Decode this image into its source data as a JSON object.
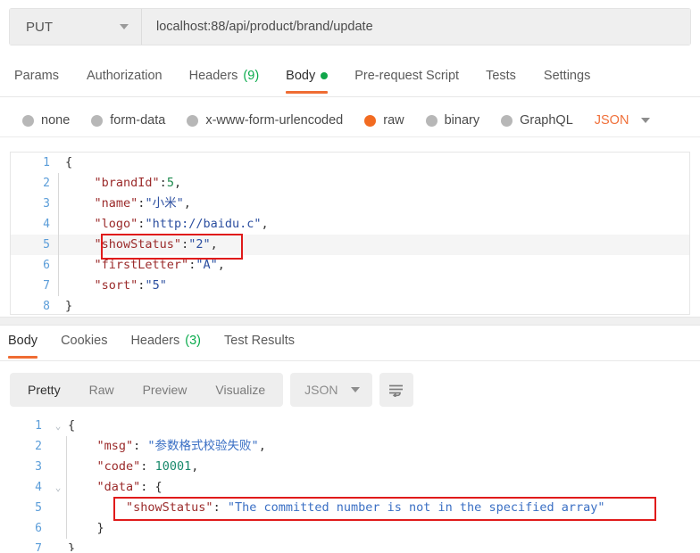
{
  "request": {
    "method": "PUT",
    "url": "localhost:88/api/product/brand/update",
    "tabs": [
      {
        "label": "Params",
        "active": false
      },
      {
        "label": "Authorization",
        "active": false
      },
      {
        "label": "Headers",
        "count": "(9)",
        "active": false
      },
      {
        "label": "Body",
        "active": true,
        "dot": true
      },
      {
        "label": "Pre-request Script",
        "active": false
      },
      {
        "label": "Tests",
        "active": false
      },
      {
        "label": "Settings",
        "active": false
      }
    ],
    "body_types": [
      {
        "label": "none",
        "selected": false
      },
      {
        "label": "form-data",
        "selected": false
      },
      {
        "label": "x-www-form-urlencoded",
        "selected": false
      },
      {
        "label": "raw",
        "selected": true
      },
      {
        "label": "binary",
        "selected": false
      },
      {
        "label": "GraphQL",
        "selected": false
      }
    ],
    "format_selected": "JSON",
    "code_lines": [
      {
        "num": "1",
        "text": "{"
      },
      {
        "num": "2",
        "text": "    \"brandId\":5,"
      },
      {
        "num": "3",
        "text": "    \"name\":\"小米\","
      },
      {
        "num": "4",
        "text": "    \"logo\":\"http://baidu.c\","
      },
      {
        "num": "5",
        "text": "    \"showStatus\":\"2\","
      },
      {
        "num": "6",
        "text": "    \"firstLetter\":\"A\","
      },
      {
        "num": "7",
        "text": "    \"sort\":\"5\""
      },
      {
        "num": "8",
        "text": "}"
      }
    ],
    "highlighted_line": "\"showStatus\":\"2\","
  },
  "response": {
    "tabs": [
      {
        "label": "Body",
        "active": true
      },
      {
        "label": "Cookies",
        "active": false
      },
      {
        "label": "Headers",
        "count": "(3)",
        "active": false
      },
      {
        "label": "Test Results",
        "active": false
      }
    ],
    "view_modes": [
      {
        "label": "Pretty",
        "active": true
      },
      {
        "label": "Raw",
        "active": false
      },
      {
        "label": "Preview",
        "active": false
      },
      {
        "label": "Visualize",
        "active": false
      }
    ],
    "format_selected": "JSON",
    "wrap_icon": "word-wrap-icon",
    "code_lines": [
      {
        "num": "1",
        "fold": "⌄",
        "text": "{"
      },
      {
        "num": "2",
        "fold": "",
        "text": "    \"msg\": \"参数格式校验失败\","
      },
      {
        "num": "3",
        "fold": "",
        "text": "    \"code\": 10001,"
      },
      {
        "num": "4",
        "fold": "⌄",
        "text": "    \"data\": {"
      },
      {
        "num": "5",
        "fold": "",
        "text": "        \"showStatus\": \"The committed number is not in the specified array\""
      },
      {
        "num": "6",
        "fold": "",
        "text": "    }"
      },
      {
        "num": "7",
        "fold": "",
        "text": "}"
      }
    ],
    "highlighted_line": "\"showStatus\": \"The committed number is not in the specified array\"",
    "msg": "参数格式校验失败",
    "code": "10001",
    "data_showStatus": "The committed number is not in the specified array"
  },
  "colors": {
    "accent": "#ef6c33",
    "highlight_box": "#e01b1b",
    "success_dot": "#11a64a",
    "count_green": "#0cac4e"
  }
}
